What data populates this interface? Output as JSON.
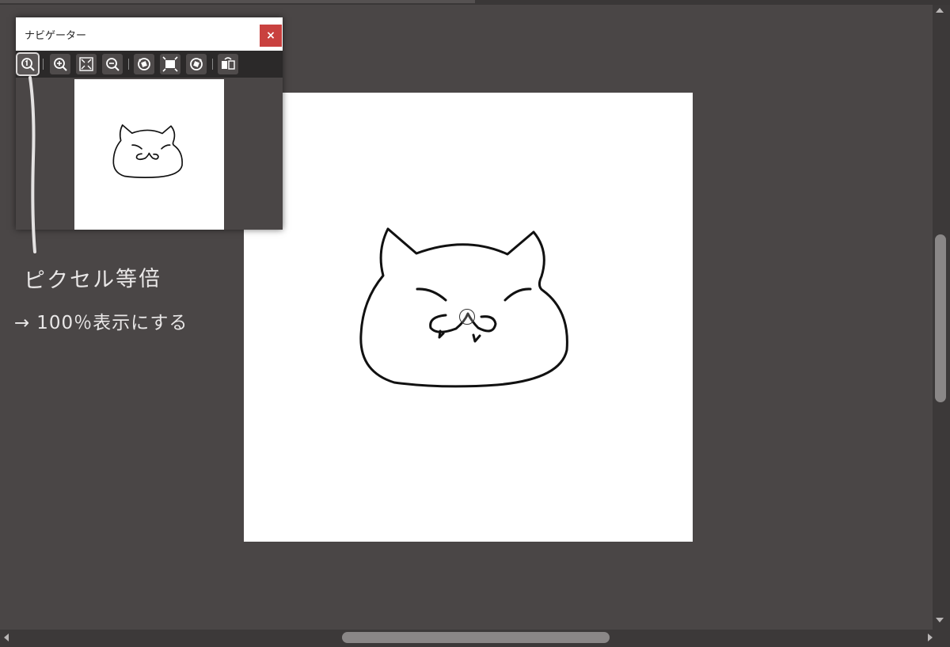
{
  "navigator": {
    "title": "ナビゲーター",
    "close_label": "×",
    "toolbar": [
      {
        "name": "actual-pixels",
        "icon": "zoom-100-icon"
      },
      {
        "name": "zoom-in",
        "icon": "zoom-in-icon"
      },
      {
        "name": "fit-to-window",
        "icon": "fit-window-icon"
      },
      {
        "name": "zoom-out",
        "icon": "zoom-out-icon"
      },
      {
        "name": "rotate-left",
        "icon": "rotate-left-icon"
      },
      {
        "name": "reset-view",
        "icon": "reset-view-icon"
      },
      {
        "name": "rotate-right",
        "icon": "rotate-right-icon"
      },
      {
        "name": "flip-horizontal",
        "icon": "flip-horizontal-icon"
      }
    ]
  },
  "annotation": {
    "line1": "ピクセル等倍",
    "arrow": "→",
    "line2": "100％表示にする"
  },
  "colors": {
    "workspace": "#4a4646",
    "canvas": "#ffffff",
    "close_button": "#c9413f",
    "toolbar": "#2b2929",
    "annotation_text": "#e9e7e7"
  }
}
